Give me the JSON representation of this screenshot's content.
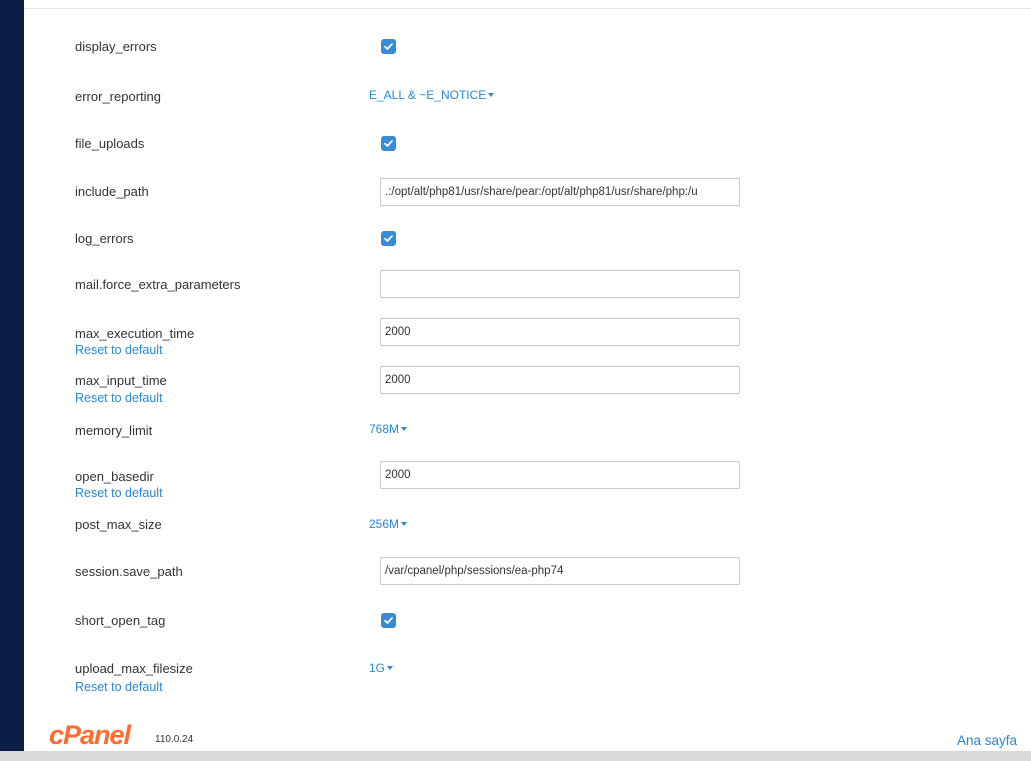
{
  "settings": [
    {
      "key": "display_errors",
      "type": "checkbox",
      "checked": true
    },
    {
      "key": "error_reporting",
      "type": "dropdown",
      "value": "E_ALL & ~E_NOTICE"
    },
    {
      "key": "file_uploads",
      "type": "checkbox",
      "checked": true
    },
    {
      "key": "include_path",
      "type": "text",
      "value": ".:/opt/alt/php81/usr/share/pear:/opt/alt/php81/usr/share/php:/u"
    },
    {
      "key": "log_errors",
      "type": "checkbox",
      "checked": true
    },
    {
      "key": "mail.force_extra_parameters",
      "type": "text",
      "value": ""
    },
    {
      "key": "max_execution_time",
      "type": "text",
      "value": "2000",
      "reset": "Reset to default"
    },
    {
      "key": "max_input_time",
      "type": "text",
      "value": "2000",
      "reset": "Reset to default"
    },
    {
      "key": "memory_limit",
      "type": "dropdown",
      "value": "768M"
    },
    {
      "key": "open_basedir",
      "type": "text",
      "value": "2000",
      "reset": "Reset to default"
    },
    {
      "key": "post_max_size",
      "type": "dropdown",
      "value": "256M"
    },
    {
      "key": "session.save_path",
      "type": "text",
      "value": "/var/cpanel/php/sessions/ea-php74"
    },
    {
      "key": "short_open_tag",
      "type": "checkbox",
      "checked": true
    },
    {
      "key": "upload_max_filesize",
      "type": "dropdown",
      "value": "1G",
      "reset": "Reset to default"
    }
  ],
  "footer": {
    "logo": "cPanel",
    "version": "110.0.24",
    "home_link": "Ana sayfa"
  },
  "colors": {
    "sidebar": "#0a1e46",
    "link": "#2b87d1",
    "checkbox": "#3a8bd6",
    "logo": "#ff6c2c"
  }
}
